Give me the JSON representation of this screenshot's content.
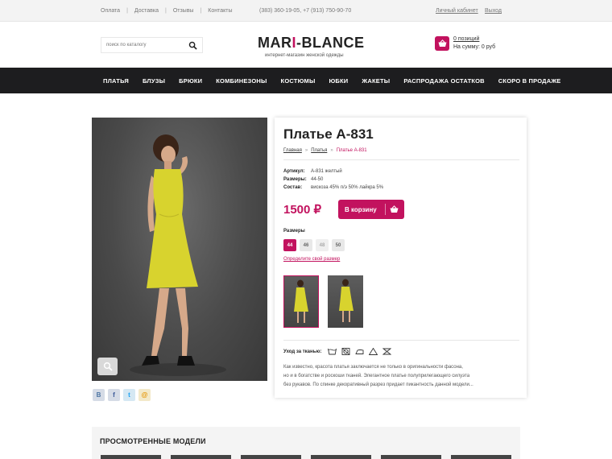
{
  "topbar": {
    "links": [
      "Оплата",
      "Доставка",
      "Отзывы",
      "Контакты"
    ],
    "separator": "|",
    "phones": "(383) 360-19-05,  +7 (913) 750-90-70",
    "account": "Личный кабинет",
    "logout": "Выход"
  },
  "header": {
    "search_placeholder": "поиск по каталогу",
    "logo_part1": "MAR",
    "logo_accent": "I",
    "logo_part2": "-BLANCE",
    "tagline": "интернет-магазин женской одежды",
    "cart_count": "0 позиций",
    "cart_sum": "На сумму: 0 руб"
  },
  "nav": {
    "items": [
      "ПЛАТЬЯ",
      "БЛУЗЫ",
      "БРЮКИ",
      "КОМБИНЕЗОНЫ",
      "КОСТЮМЫ",
      "ЮБКИ",
      "ЖАКЕТЫ",
      "РАСПРОДАЖА ОСТАТКОВ",
      "СКОРО В ПРОДАЖЕ"
    ]
  },
  "social": [
    "B",
    "f",
    "t",
    "@"
  ],
  "product": {
    "title": "Платье А-831",
    "breadcrumbs": [
      "Главная",
      "Платья"
    ],
    "breadcrumb_current": "Платье А-831",
    "breadcrumb_arrow": "»",
    "props": [
      {
        "key": "Артикул:",
        "value": "А-831 желтый"
      },
      {
        "key": "Размеры:",
        "value": "44-50"
      },
      {
        "key": "Состав:",
        "value": "вискоза 45% п/э 50% лайкра 5%"
      }
    ],
    "price": "1500 ₽",
    "buy_label": "В корзину",
    "sizes_label": "Размеры",
    "sizes": [
      {
        "label": "44",
        "state": "active"
      },
      {
        "label": "46",
        "state": "normal"
      },
      {
        "label": "48",
        "state": "disabled"
      },
      {
        "label": "50",
        "state": "normal"
      }
    ],
    "size_link": "Определите свой размер",
    "care_label": "Уход за тканью:",
    "description_lines": [
      "Как известно, красота платья заключается не только в оригинальности фасона,",
      "но и в богатстве и роскоши тканей. Элегантное платье полуприлегающего силуэта",
      "без рукавов. По спинке декоративный разрез придает пикантность данной модели..."
    ]
  },
  "viewed": {
    "title": "ПРОСМОТРЕННЫЕ МОДЕЛИ"
  },
  "colors": {
    "accent": "#c2125e",
    "nav_bg": "#1d1d1f",
    "dress": "#d8d32e"
  }
}
